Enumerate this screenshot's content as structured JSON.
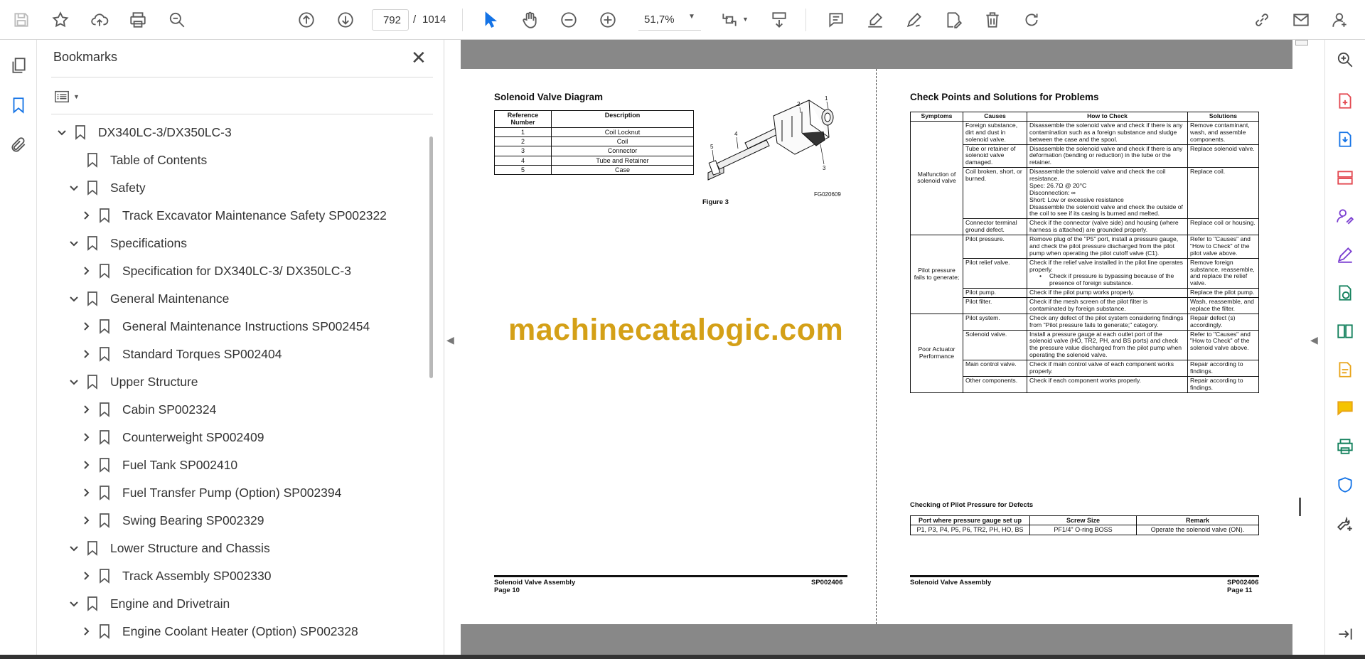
{
  "toolbar": {
    "current_page": "792",
    "page_separator": "/",
    "total_pages": "1014",
    "zoom": "51,7%"
  },
  "bookmarks": {
    "title": "Bookmarks",
    "items": [
      {
        "label": "DX340LC-3/DX350LC-3",
        "level": 0,
        "chevron": "down"
      },
      {
        "label": "Table of Contents",
        "level": 1,
        "chevron": "none"
      },
      {
        "label": "Safety",
        "level": 1,
        "chevron": "down"
      },
      {
        "label": "Track Excavator Maintenance Safety SP002322",
        "level": 2,
        "chevron": "right"
      },
      {
        "label": "Specifications",
        "level": 1,
        "chevron": "down"
      },
      {
        "label": "Specification for DX340LC-3/ DX350LC-3",
        "level": 2,
        "chevron": "right"
      },
      {
        "label": "General Maintenance",
        "level": 1,
        "chevron": "down"
      },
      {
        "label": "General Maintenance Instructions SP002454",
        "level": 2,
        "chevron": "right"
      },
      {
        "label": "Standard Torques SP002404",
        "level": 2,
        "chevron": "right"
      },
      {
        "label": "Upper Structure",
        "level": 1,
        "chevron": "down"
      },
      {
        "label": "Cabin SP002324",
        "level": 2,
        "chevron": "right"
      },
      {
        "label": "Counterweight SP002409",
        "level": 2,
        "chevron": "right"
      },
      {
        "label": "Fuel Tank SP002410",
        "level": 2,
        "chevron": "right"
      },
      {
        "label": "Fuel Transfer Pump (Option) SP002394",
        "level": 2,
        "chevron": "right"
      },
      {
        "label": "Swing Bearing SP002329",
        "level": 2,
        "chevron": "right"
      },
      {
        "label": "Lower Structure and Chassis",
        "level": 1,
        "chevron": "down"
      },
      {
        "label": "Track Assembly SP002330",
        "level": 2,
        "chevron": "right"
      },
      {
        "label": "Engine and Drivetrain",
        "level": 1,
        "chevron": "down"
      },
      {
        "label": "Engine Coolant Heater (Option) SP002328",
        "level": 2,
        "chevron": "right"
      }
    ]
  },
  "left_page": {
    "heading": "Solenoid Valve Diagram",
    "table_headers": [
      "Reference Number",
      "Description"
    ],
    "rows": [
      {
        "num": "1",
        "desc": "Coil Locknut"
      },
      {
        "num": "2",
        "desc": "Coil"
      },
      {
        "num": "3",
        "desc": "Connector"
      },
      {
        "num": "4",
        "desc": "Tube and Retainer"
      },
      {
        "num": "5",
        "desc": "Case"
      }
    ],
    "figure_caption": "Figure 3",
    "figure_code": "FG020609",
    "callouts": [
      "1",
      "2",
      "3",
      "4",
      "5"
    ],
    "footer_title": "Solenoid Valve Assembly",
    "footer_code": "SP002406",
    "footer_page": "Page 10"
  },
  "watermark": "machinecatalogic.com",
  "right_page": {
    "heading": "Check Points and Solutions for Problems",
    "table_headers": [
      "Symptoms",
      "Causes",
      "How to Check",
      "Solutions"
    ],
    "groups": [
      {
        "symptom": "Malfunction of solenoid valve",
        "rows": [
          {
            "cause": "Foreign substance, dirt and dust in solenoid valve.",
            "check": "Disassemble the solenoid valve and check if there is any contamination such as a foreign substance and sludge between the case and the spool.",
            "solution": "Remove contaminant, wash, and assemble components."
          },
          {
            "cause": "Tube or retainer of solenoid valve damaged.",
            "check": "Disassemble the solenoid valve and check if there is any deformation (bending or reduction) in the tube or the retainer.",
            "solution": "Replace solenoid valve."
          },
          {
            "cause": "Coil broken, short, or burned.",
            "check": "Disassemble the solenoid valve and check the coil resistance.\nSpec: 26.7Ω @ 20°C\nDisconnection: ∞\nShort: Low or excessive resistance\nDisassemble the solenoid valve and check the outside of the coil to see if its casing is burned and melted.",
            "solution": "Replace coil."
          },
          {
            "cause": "Connector terminal ground defect.",
            "check": "Check if the connector (valve side) and housing (where harness is attached) are grounded properly.",
            "solution": "Replace coil or housing."
          }
        ]
      },
      {
        "symptom": "Pilot pressure fails to generate;",
        "rows": [
          {
            "cause": "Pilot pressure.",
            "check": "Remove plug of the \"P5\" port, install a pressure gauge, and check the pilot pressure discharged from the pilot pump when operating the pilot cutoff valve (C1).",
            "solution": "Refer to \"Causes\" and \"How to Check\" of the pilot valve above."
          },
          {
            "cause": "Pilot relief valve.",
            "check": "Check if the relief valve installed in the pilot line operates properly.",
            "bullet": "Check if pressure is bypassing because of the presence of foreign substance.",
            "solution": "Remove foreign substance, reassemble, and replace the relief valve."
          },
          {
            "cause": "Pilot pump.",
            "check": "Check if the pilot pump works properly.",
            "solution": "Replace the pilot pump."
          },
          {
            "cause": "Pilot filter.",
            "check": "Check if the mesh screen of the pilot filter is contaminated by foreign substance.",
            "solution": "Wash, reassemble, and replace the filter."
          }
        ]
      },
      {
        "symptom": "Poor Actuator Performance",
        "rows": [
          {
            "cause": "Pilot system.",
            "check": "Check any defect of the pilot system considering findings from \"Pilot pressure fails to generate;\" category.",
            "solution": "Repair defect (s) accordingly."
          },
          {
            "cause": "Solenoid valve.",
            "check": "Install a pressure gauge at each outlet port of the solenoid valve (HO, TR2, PH, and BS ports) and check the pressure value discharged from the pilot pump when operating the solenoid valve.",
            "solution": "Refer to \"Causes\" and \"How to Check\" of the solenoid valve above."
          },
          {
            "cause": "Main control valve.",
            "check": "Check if main control valve of each component works properly.",
            "solution": "Repair according to findings."
          },
          {
            "cause": "Other components.",
            "check": "Check if each component works properly.",
            "solution": "Repair according to findings."
          }
        ]
      }
    ],
    "subheading": "Checking of Pilot Pressure for Defects",
    "pressure_headers": [
      "Port where pressure gauge set up",
      "Screw Size",
      "Remark"
    ],
    "pressure_row": {
      "port": "P1, P3, P4, P5, P6, TR2, PH, HO, BS",
      "screw": "PF1/4\" O-ring BOSS",
      "remark": "Operate the solenoid valve (ON)."
    },
    "footer_title": "Solenoid Valve Assembly",
    "footer_code": "SP002406",
    "footer_page": "Page 11"
  }
}
